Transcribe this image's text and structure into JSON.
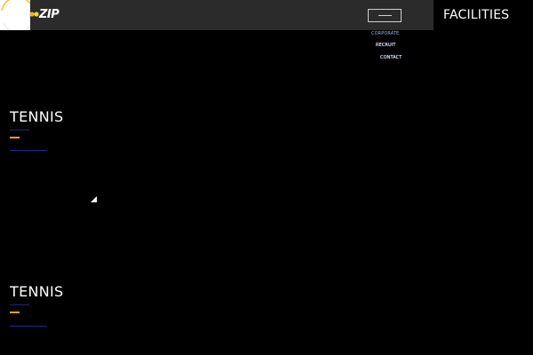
{
  "header": {
    "logo_text": "ZIP",
    "logo_icon": "sun-circle-icon",
    "menu_icon": "hamburger-menu-icon",
    "facilities_label": "FACILITIES"
  },
  "nav": {
    "items": [
      {
        "label": "CORPORATE"
      },
      {
        "label": "RECRUIT"
      },
      {
        "label": "CONTACT"
      }
    ]
  },
  "sections": [
    {
      "title": "TENNIS"
    },
    {
      "title": "TENNIS"
    }
  ],
  "colors": {
    "background": "#000000",
    "topbar": "#2b2b2b",
    "accent": "#f0a020",
    "link_underline": "#1a2a90",
    "nav_corporate": "#9fb6e6"
  }
}
